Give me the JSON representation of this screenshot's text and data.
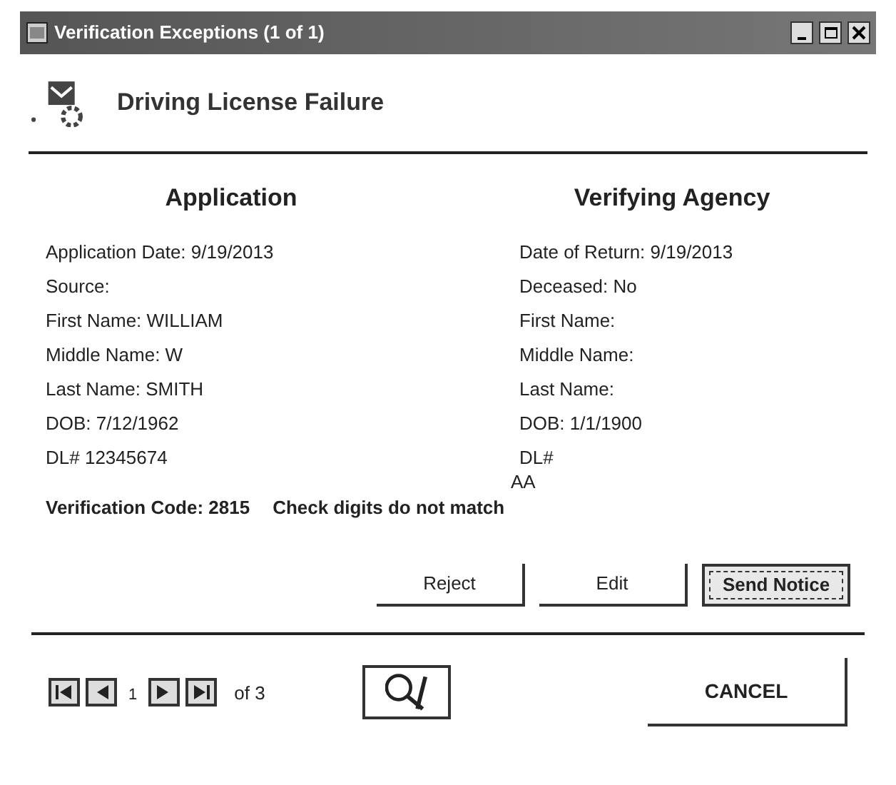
{
  "window": {
    "title": "Verification Exceptions (1 of 1)"
  },
  "header": {
    "title": "Driving License Failure"
  },
  "application": {
    "heading": "Application",
    "fields": [
      "Application Date:  9/19/2013",
      "Source:",
      "First Name: WILLIAM",
      "Middle Name: W",
      "Last Name: SMITH",
      "DOB: 7/12/1962",
      "DL# 12345674"
    ]
  },
  "agency": {
    "heading": "Verifying Agency",
    "fields": [
      "Date of Return: 9/19/2013",
      "Deceased: No",
      "First Name:",
      "Middle Name:",
      "Last Name:",
      "DOB: 1/1/1900",
      "DL#"
    ],
    "note": "AA"
  },
  "verification": {
    "code": "Verification Code: 2815",
    "message": "Check digits do not match"
  },
  "actions": [
    {
      "label": "Reject",
      "focused": false
    },
    {
      "label": "Edit",
      "focused": false
    },
    {
      "label": "Send Notice",
      "focused": true
    }
  ],
  "pager": {
    "current": "1",
    "total": "of 3"
  },
  "cancel": {
    "label": "CANCEL"
  }
}
